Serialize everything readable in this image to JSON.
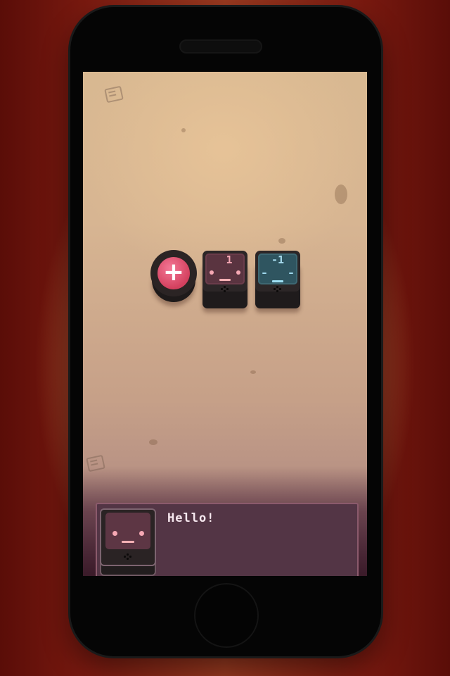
{
  "pieces": {
    "plus": {
      "symbol": "+",
      "color": "#d3405e"
    },
    "block_positive": {
      "value": "1",
      "color": "#5a3440"
    },
    "block_negative": {
      "value": "-1",
      "color": "#2f5560"
    }
  },
  "dialog": {
    "text": "Hello!",
    "speaker_color": "#5d3644"
  },
  "icons": [
    "corner-badge-icon",
    "plus-icon",
    "face-icon",
    "home-button"
  ]
}
